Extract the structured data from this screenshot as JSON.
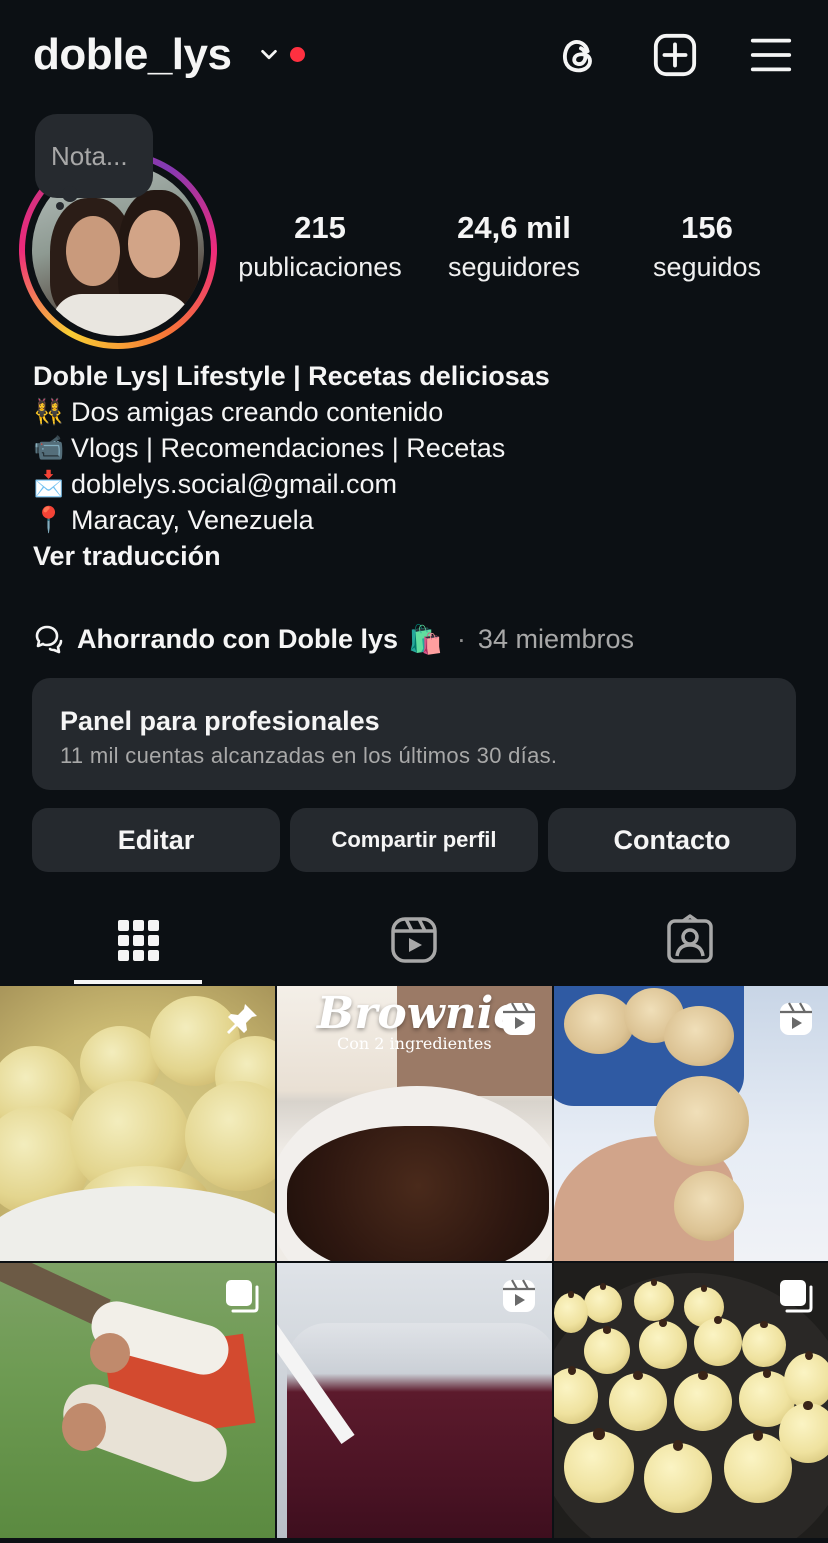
{
  "header": {
    "username": "doble_lys",
    "icons": [
      "chevron-down-icon",
      "threads-icon",
      "add-post-icon",
      "menu-icon"
    ],
    "notification_dot_color": "#ff3040"
  },
  "note": {
    "placeholder": "Nota..."
  },
  "stats": [
    {
      "value": "215",
      "label": "publicaciones"
    },
    {
      "value": "24,6 mil",
      "label": "seguidores"
    },
    {
      "value": "156",
      "label": "seguidos"
    }
  ],
  "bio": {
    "name": "Doble Lys| Lifestyle | Recetas deliciosas",
    "lines": [
      {
        "emoji": "👯‍♀️",
        "text": "Dos amigas creando contenido"
      },
      {
        "emoji": "📹",
        "text": "Vlogs | Recomendaciones | Recetas"
      },
      {
        "emoji": "📩",
        "text": "doblelys.social@gmail.com"
      },
      {
        "emoji": "📍",
        "text": "Maracay, Venezuela"
      }
    ],
    "translate_link": "Ver traducción"
  },
  "channel": {
    "name": "Ahorrando con Doble lys",
    "emoji": "🛍️",
    "separator": "·",
    "members": "34 miembros"
  },
  "pro_panel": {
    "title": "Panel para profesionales",
    "subtitle": "11 mil cuentas alcanzadas en los últimos 30 días."
  },
  "buttons": {
    "edit": "Editar",
    "share": "Compartir perfil",
    "contact": "Contacto"
  },
  "tabs": [
    {
      "icon": "grid-icon",
      "active": true
    },
    {
      "icon": "reels-icon",
      "active": false
    },
    {
      "icon": "tagged-icon",
      "active": false
    }
  ],
  "posts": [
    {
      "badge": "pin-icon"
    },
    {
      "badge": "reel-icon",
      "overlay_title": "Brownie",
      "overlay_subtitle": "Con 2 ingredientes"
    },
    {
      "badge": "reel-icon"
    },
    {
      "badge": "carousel-icon"
    },
    {
      "badge": "reel-icon"
    },
    {
      "badge": "carousel-icon"
    }
  ],
  "colors": {
    "background": "#0c1014",
    "card": "#25292e",
    "muted_text": "#a8a8a8"
  }
}
